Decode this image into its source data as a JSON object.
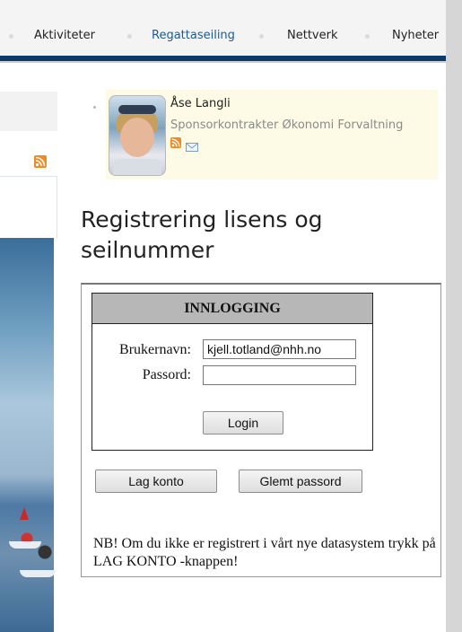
{
  "nav": {
    "items": [
      {
        "label": "Aktiviteter",
        "active": false
      },
      {
        "label": "Regattaseiling",
        "active": true
      },
      {
        "label": "Nettverk",
        "active": false
      },
      {
        "label": "Nyheter",
        "active": false
      }
    ]
  },
  "contact": {
    "name": "Åse Langli",
    "role": "Sponsorkontrakter Økonomi Forvaltning",
    "icons": [
      "rss-icon",
      "mail-icon"
    ]
  },
  "page_title": "Registrering lisens og seilnummer",
  "login": {
    "header": "INNLOGGING",
    "username_label": "Brukernavn:",
    "username_value": "kjell.totland@nhh.no",
    "password_label": "Passord:",
    "password_value": "",
    "login_button": "Login"
  },
  "actions": {
    "create_account": "Lag konto",
    "forgot_password": "Glemt passord"
  },
  "note": "NB! Om du ikke er registrert i vårt nye datasystem trykk på LAG KONTO -knappen!",
  "colors": {
    "nav_bar": "#0d3a66",
    "nav_active": "#1c5b93",
    "contact_bg": "#fdfbe5",
    "rss": "#f08a24",
    "login_header_bg": "#b7b7b7"
  }
}
